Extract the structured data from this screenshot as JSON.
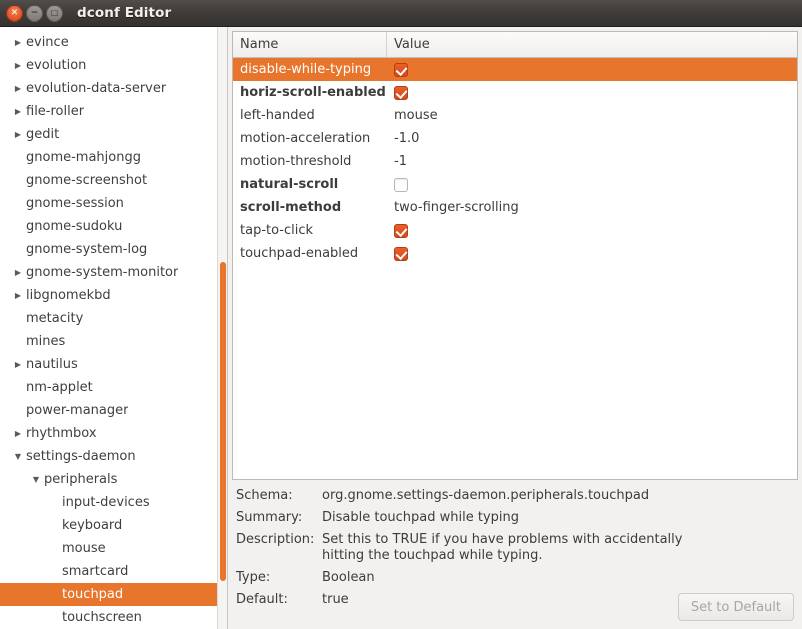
{
  "window": {
    "title": "dconf Editor",
    "controls": [
      {
        "name": "close",
        "glyph": "✕"
      },
      {
        "name": "minimize",
        "glyph": "−"
      },
      {
        "name": "maximize",
        "glyph": "□"
      }
    ]
  },
  "colors": {
    "accent": "#e8752c",
    "checkbox_on": "#d6491c",
    "titlebar": "#3e3b39",
    "selection_text": "#ffffff"
  },
  "sidebar": {
    "scrollbar": {
      "thumb_top_pct": 39,
      "thumb_height_pct": 53
    },
    "items": [
      {
        "label": "evince",
        "depth": 0,
        "arrow": "collapsed",
        "selected": false
      },
      {
        "label": "evolution",
        "depth": 0,
        "arrow": "collapsed",
        "selected": false
      },
      {
        "label": "evolution-data-server",
        "depth": 0,
        "arrow": "collapsed",
        "selected": false
      },
      {
        "label": "file-roller",
        "depth": 0,
        "arrow": "collapsed",
        "selected": false
      },
      {
        "label": "gedit",
        "depth": 0,
        "arrow": "collapsed",
        "selected": false
      },
      {
        "label": "gnome-mahjongg",
        "depth": 0,
        "arrow": "none",
        "selected": false
      },
      {
        "label": "gnome-screenshot",
        "depth": 0,
        "arrow": "none",
        "selected": false
      },
      {
        "label": "gnome-session",
        "depth": 0,
        "arrow": "none",
        "selected": false
      },
      {
        "label": "gnome-sudoku",
        "depth": 0,
        "arrow": "none",
        "selected": false
      },
      {
        "label": "gnome-system-log",
        "depth": 0,
        "arrow": "none",
        "selected": false
      },
      {
        "label": "gnome-system-monitor",
        "depth": 0,
        "arrow": "collapsed",
        "selected": false
      },
      {
        "label": "libgnomekbd",
        "depth": 0,
        "arrow": "collapsed",
        "selected": false
      },
      {
        "label": "metacity",
        "depth": 0,
        "arrow": "none",
        "selected": false
      },
      {
        "label": "mines",
        "depth": 0,
        "arrow": "none",
        "selected": false
      },
      {
        "label": "nautilus",
        "depth": 0,
        "arrow": "collapsed",
        "selected": false
      },
      {
        "label": "nm-applet",
        "depth": 0,
        "arrow": "none",
        "selected": false
      },
      {
        "label": "power-manager",
        "depth": 0,
        "arrow": "none",
        "selected": false
      },
      {
        "label": "rhythmbox",
        "depth": 0,
        "arrow": "collapsed",
        "selected": false
      },
      {
        "label": "settings-daemon",
        "depth": 0,
        "arrow": "expanded",
        "selected": false
      },
      {
        "label": "peripherals",
        "depth": 1,
        "arrow": "expanded",
        "selected": false
      },
      {
        "label": "input-devices",
        "depth": 2,
        "arrow": "none",
        "selected": false
      },
      {
        "label": "keyboard",
        "depth": 2,
        "arrow": "none",
        "selected": false
      },
      {
        "label": "mouse",
        "depth": 2,
        "arrow": "none",
        "selected": false
      },
      {
        "label": "smartcard",
        "depth": 2,
        "arrow": "none",
        "selected": false
      },
      {
        "label": "touchpad",
        "depth": 2,
        "arrow": "none",
        "selected": true
      },
      {
        "label": "touchscreen",
        "depth": 2,
        "arrow": "none",
        "selected": false
      }
    ]
  },
  "list": {
    "columns": [
      {
        "key": "name",
        "label": "Name"
      },
      {
        "key": "value",
        "label": "Value"
      }
    ],
    "rows": [
      {
        "name": "disable-while-typing",
        "value_type": "checkbox",
        "value": "true",
        "modified": false,
        "selected": true
      },
      {
        "name": "horiz-scroll-enabled",
        "value_type": "checkbox",
        "value": "true",
        "modified": true,
        "selected": false
      },
      {
        "name": "left-handed",
        "value_type": "text",
        "value": "mouse",
        "modified": false,
        "selected": false
      },
      {
        "name": "motion-acceleration",
        "value_type": "text",
        "value": "-1.0",
        "modified": false,
        "selected": false
      },
      {
        "name": "motion-threshold",
        "value_type": "text",
        "value": "-1",
        "modified": false,
        "selected": false
      },
      {
        "name": "natural-scroll",
        "value_type": "checkbox",
        "value": "false",
        "modified": true,
        "selected": false
      },
      {
        "name": "scroll-method",
        "value_type": "text",
        "value": "two-finger-scrolling",
        "modified": true,
        "selected": false
      },
      {
        "name": "tap-to-click",
        "value_type": "checkbox",
        "value": "true",
        "modified": false,
        "selected": false
      },
      {
        "name": "touchpad-enabled",
        "value_type": "checkbox",
        "value": "true",
        "modified": false,
        "selected": false
      }
    ]
  },
  "detail": {
    "schema_label": "Schema:",
    "schema_value": "org.gnome.settings-daemon.peripherals.touchpad",
    "summary_label": "Summary:",
    "summary_value": "Disable touchpad while typing",
    "description_label": "Description:",
    "description_value": "Set this to TRUE if you have problems with accidentally hitting the touchpad while typing.",
    "type_label": "Type:",
    "type_value": "Boolean",
    "default_label": "Default:",
    "default_value": "true",
    "set_to_default_button": "Set to Default"
  }
}
